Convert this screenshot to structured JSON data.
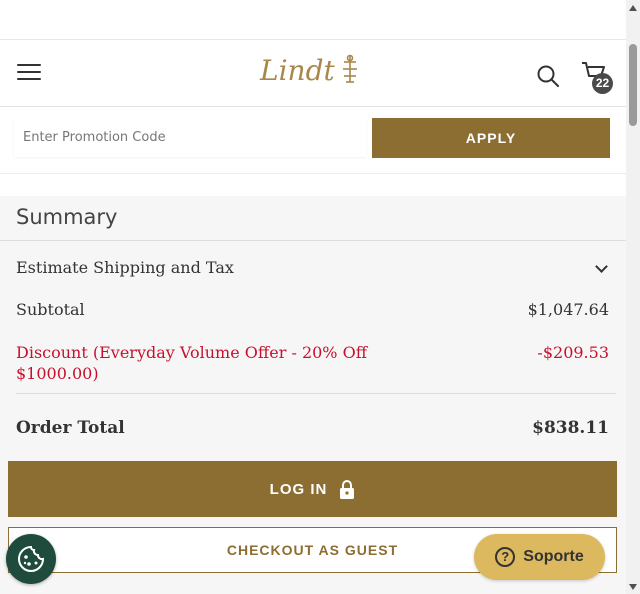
{
  "header": {
    "logo_text": "Lindt",
    "cart_count": "22"
  },
  "promo": {
    "placeholder": "Enter Promotion Code",
    "apply_label": "APPLY"
  },
  "summary": {
    "title": "Summary",
    "estimate_label": "Estimate Shipping and Tax",
    "subtotal_label": "Subtotal",
    "subtotal_value": "$1,047.64",
    "discount_label": "Discount (Everyday Volume Offer - 20% Off $1000.00)",
    "discount_value": "-$209.53",
    "total_label": "Order Total",
    "total_value": "$838.11"
  },
  "actions": {
    "login_label": "LOG IN",
    "guest_label": "CHECKOUT AS GUEST",
    "support_label": "Soporte"
  },
  "colors": {
    "brand_gold": "#8d6e32",
    "discount_red": "#c8102e",
    "support_yellow": "#dcb85e",
    "cookie_green": "#1f4b3d"
  }
}
